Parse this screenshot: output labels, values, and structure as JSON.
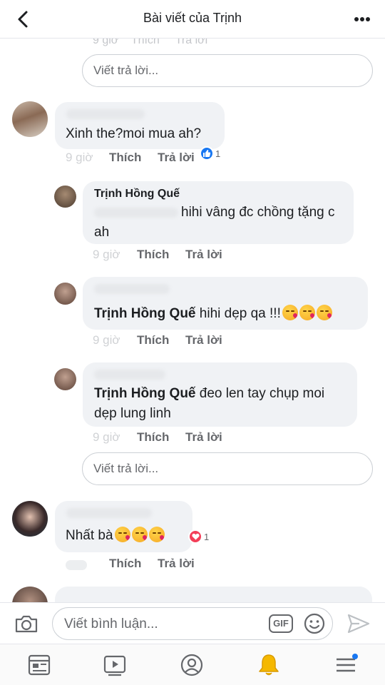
{
  "header": {
    "title": "Bài viết của Trịnh"
  },
  "faded_meta": {
    "time": "9 giờ",
    "like": "Thích",
    "reply": "Trả lời"
  },
  "reply_placeholder": "Viết trả lời...",
  "comments": [
    {
      "text": "Xinh the?moi mua ah?",
      "time": "9 giờ",
      "like": "Thích",
      "reply": "Trả lời",
      "reaction_count": "1"
    },
    {
      "name": "Trịnh Hồng Quế",
      "text_line1": "hihi vâng đc chồng tặng c",
      "text_line2": "ah",
      "time": "9 giờ",
      "like": "Thích",
      "reply": "Trả lời"
    },
    {
      "name": "Trịnh Hồng Quế",
      "text": "hihi dẹp qa !!!",
      "time": "9 giờ",
      "like": "Thích",
      "reply": "Trả lời"
    },
    {
      "name": "Trịnh Hồng Quế",
      "text_line1": "đeo len tay chụp moi",
      "text_line2": "dẹp lung linh",
      "time": "9 giờ",
      "like": "Thích",
      "reply": "Trả lời"
    },
    {
      "text": "Nhất bà",
      "like": "Thích",
      "reply": "Trả lời",
      "reaction_count": "1"
    }
  ],
  "composer": {
    "placeholder": "Viết bình luận...",
    "gif_label": "GIF"
  },
  "colors": {
    "like_blue": "#1877f2",
    "love_red": "#f33e58",
    "notify_blue": "#1877f2"
  },
  "icons": [
    "back-arrow-icon",
    "more-dots-icon",
    "camera-icon",
    "gif-icon",
    "smile-icon",
    "send-icon",
    "news-feed-icon",
    "watch-icon",
    "profile-icon",
    "bell-icon",
    "menu-icon"
  ]
}
